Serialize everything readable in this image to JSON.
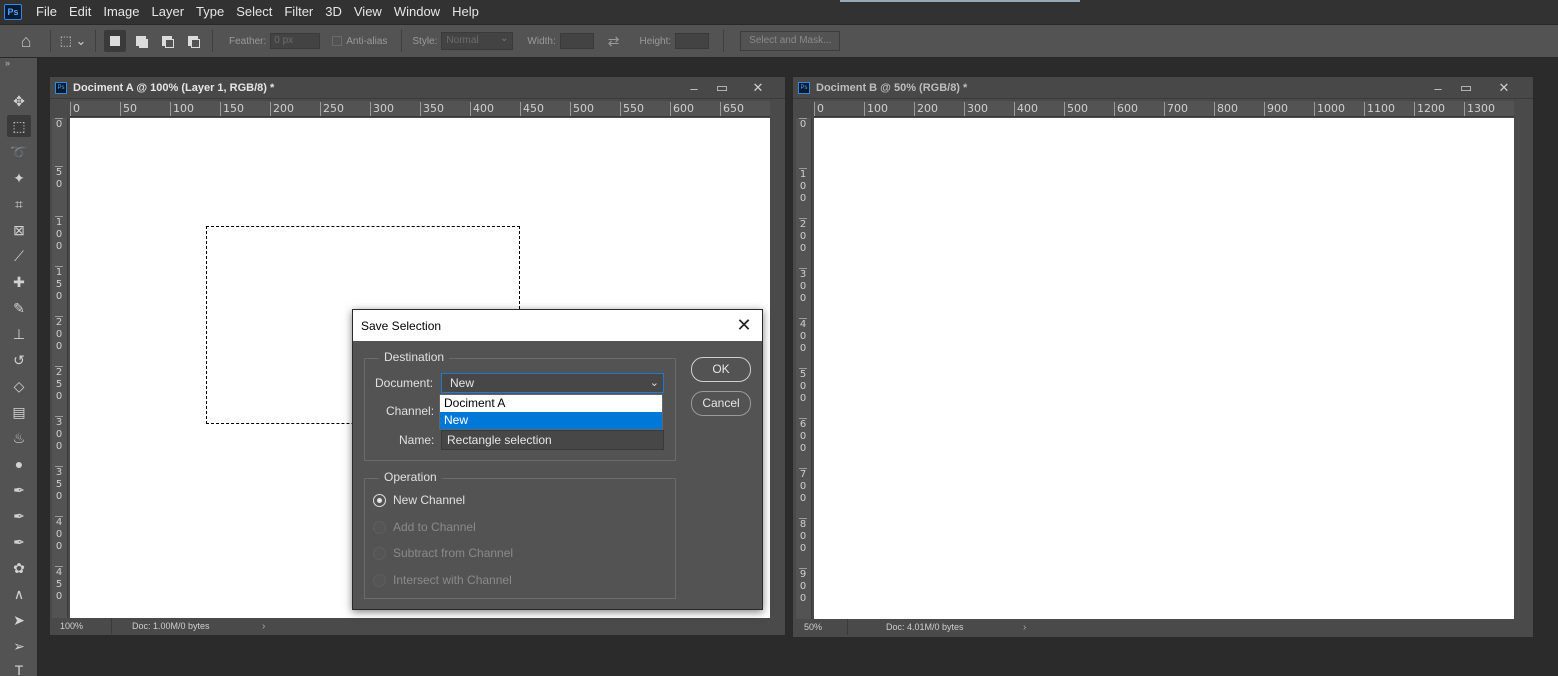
{
  "menubar": {
    "logo": "Ps",
    "items": [
      "File",
      "Edit",
      "Image",
      "Layer",
      "Type",
      "Select",
      "Filter",
      "3D",
      "View",
      "Window",
      "Help"
    ]
  },
  "options": {
    "feather_label": "Feather:",
    "feather_value": "0 px",
    "antialias_label": "Anti-alias",
    "style_label": "Style:",
    "style_value": "Normal",
    "width_label": "Width:",
    "height_label": "Height:",
    "select_mask_label": "Select and Mask..."
  },
  "doc_a": {
    "title": "Dociment A @ 100% (Layer 1, RGB/8) *",
    "ruler_h": [
      "0",
      "50",
      "100",
      "150",
      "200",
      "250",
      "300",
      "350",
      "400",
      "450",
      "500",
      "550",
      "600",
      "650"
    ],
    "ruler_v": [
      "0",
      "5 0",
      "1 0 0",
      "1 5 0",
      "2 0 0",
      "2 5 0",
      "3 0 0",
      "3 5 0",
      "4 0 0",
      "4 5 0"
    ],
    "zoom": "100%",
    "doc_info": "Doc: 1.00M/0 bytes"
  },
  "doc_b": {
    "title": "Dociment B @ 50% (RGB/8) *",
    "ruler_h": [
      "0",
      "100",
      "200",
      "300",
      "400",
      "500",
      "600",
      "700",
      "800",
      "900",
      "1000",
      "1100",
      "1200",
      "1300"
    ],
    "ruler_v": [
      "0",
      "1 0 0",
      "2 0 0",
      "3 0 0",
      "4 0 0",
      "5 0 0",
      "6 0 0",
      "7 0 0",
      "8 0 0",
      "9 0 0"
    ],
    "zoom": "50%",
    "doc_info": "Doc: 4.01M/0 bytes"
  },
  "dialog": {
    "title": "Save Selection",
    "destination_label": "Destination",
    "document_label": "Document:",
    "document_value": "New",
    "channel_label": "Channel:",
    "name_label": "Name:",
    "name_value": "Rectangle selection",
    "dropdown_options": [
      "Dociment A",
      "New"
    ],
    "ok_label": "OK",
    "cancel_label": "Cancel",
    "operation_label": "Operation",
    "operations": [
      "New Channel",
      "Add to Channel",
      "Subtract from Channel",
      "Intersect with Channel"
    ],
    "selected_operation": "New Channel"
  }
}
